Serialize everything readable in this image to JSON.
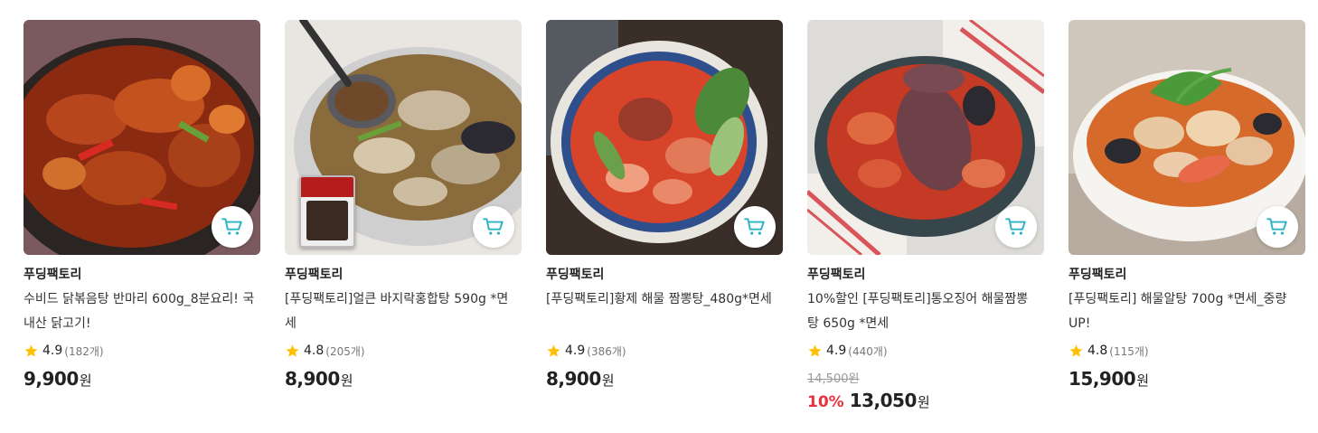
{
  "products": [
    {
      "brand": "푸딩팩토리",
      "title": "수비드 닭볶음탕 반마리 600g_8분요리! 국내산 닭고기!",
      "rating": "4.9",
      "reviews": "(182개)",
      "original_price": "",
      "discount": "",
      "price": "9,900",
      "currency": "원",
      "image_icon": "braised-chicken-image"
    },
    {
      "brand": "푸딩팩토리",
      "title": "[푸딩팩토리]얼큰 바지락홍합탕 590g *면세",
      "rating": "4.8",
      "reviews": "(205개)",
      "original_price": "",
      "discount": "",
      "price": "8,900",
      "currency": "원",
      "image_icon": "clam-soup-image"
    },
    {
      "brand": "푸딩팩토리",
      "title": "[푸딩팩토리]황제 해물 짬뽕탕_480g*면세",
      "rating": "4.9",
      "reviews": "(386개)",
      "original_price": "",
      "discount": "",
      "price": "8,900",
      "currency": "원",
      "image_icon": "seafood-jjamppong-image"
    },
    {
      "brand": "푸딩팩토리",
      "title": "10%할인 [푸딩팩토리]통오징어 해물짬뽕탕 650g *면세",
      "rating": "4.9",
      "reviews": "(440개)",
      "original_price": "14,500원",
      "discount": "10%",
      "price": "13,050",
      "currency": "원",
      "image_icon": "squid-jjamppong-image"
    },
    {
      "brand": "푸딩팩토리",
      "title": "[푸딩팩토리] 해물알탕 700g *면세_중량UP!",
      "rating": "4.8",
      "reviews": "(115개)",
      "original_price": "",
      "discount": "",
      "price": "15,900",
      "currency": "원",
      "image_icon": "fish-roe-soup-image"
    }
  ],
  "colors": {
    "discount": "#e8323f",
    "cart_icon": "#2bb3c4",
    "star": "#ffc107"
  }
}
